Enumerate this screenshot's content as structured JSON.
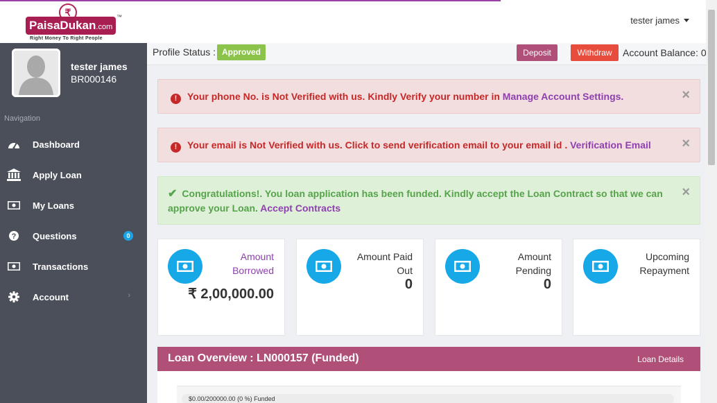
{
  "brand": {
    "logo_text": "PaisaDukan",
    "logo_domain": ".com",
    "tagline": "Right Money To Right People"
  },
  "header": {
    "user_name": "tester james"
  },
  "sidebar": {
    "profile": {
      "name": "tester james",
      "id": "BR000146"
    },
    "nav_heading": "Navigation",
    "items": [
      {
        "label": "Dashboard",
        "icon": "dashboard-icon"
      },
      {
        "label": "Apply Loan",
        "icon": "bank-icon"
      },
      {
        "label": "My Loans",
        "icon": "money-icon"
      },
      {
        "label": "Questions",
        "icon": "question-icon",
        "badge": "0"
      },
      {
        "label": "Transactions",
        "icon": "money-icon"
      },
      {
        "label": "Account",
        "icon": "gear-icon",
        "chevron": "›"
      }
    ]
  },
  "status_bar": {
    "profile_status_label": "Profile Status :",
    "profile_status_value": "Approved",
    "deposit_label": "Deposit",
    "withdraw_label": "Withdraw",
    "balance_text": "Account Balance: 0"
  },
  "alerts": {
    "phone": {
      "text": "Your phone No. is Not Verified with us. Kindly Verify your number in ",
      "link": "Manage Account Settings.",
      "close": "×"
    },
    "email": {
      "text": "Your email is Not Verified with us. Click to send verification email to your email id . ",
      "link": "Verification Email",
      "close": "×"
    },
    "funded": {
      "text": "Congratulations!. You loan application has been funded. Kindly accept the Loan Contract so that we can approve your Loan.  ",
      "link": "Accept Contracts",
      "close": "×"
    }
  },
  "stats": [
    {
      "title": "Amount Borrowed",
      "value": "₹ 2,00,000.00",
      "title_color": "#8e3fb0"
    },
    {
      "title": "Amount Paid Out",
      "value": "0",
      "title_color": "#333333"
    },
    {
      "title": "Amount Pending",
      "value": "0",
      "title_color": "#333333"
    },
    {
      "title": "Upcoming Repayment",
      "value": "",
      "title_color": "#333333"
    }
  ],
  "loan_overview": {
    "title": "Loan Overview : LN000157 (Funded)",
    "details_link": "Loan Details",
    "progress_text": "$0.00/200000.00 (0 %) Funded",
    "progress_fraction": 0.0
  },
  "colors": {
    "brand": "#a81d52",
    "sidebar": "#4a4f5a",
    "accent_blue": "#17a8e8",
    "approved_green": "#8cc34b",
    "deposit": "#b04f78",
    "withdraw": "#e84c3d"
  }
}
